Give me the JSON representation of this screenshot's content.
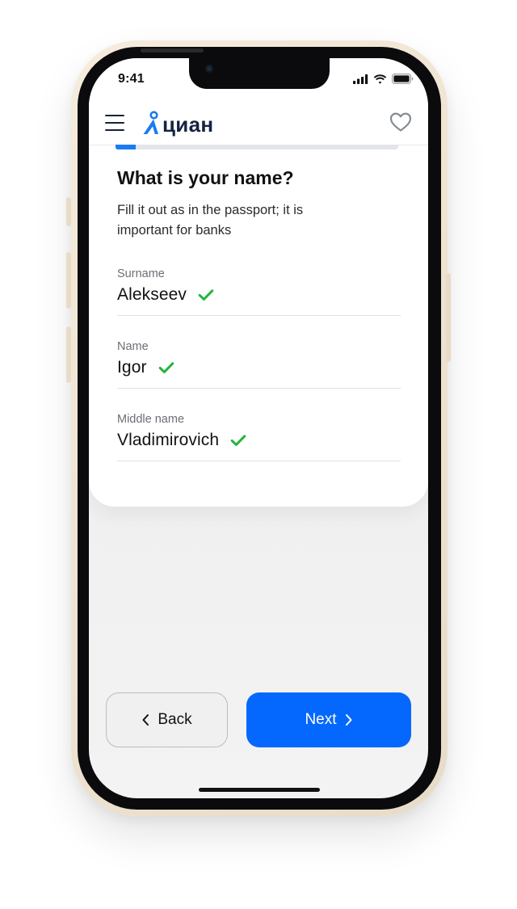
{
  "status_bar": {
    "time": "9:41"
  },
  "header": {
    "logo_text": "циан",
    "menu_icon": "hamburger-menu-icon",
    "favorite_icon": "heart-outline-icon"
  },
  "progress": {
    "fraction": 0.07
  },
  "form": {
    "title": "What is your name?",
    "subtitle": "Fill it out as in the passport; it is important for banks",
    "fields": [
      {
        "label": "Surname",
        "value": "Alekseev",
        "valid": true
      },
      {
        "label": "Name",
        "value": "Igor",
        "valid": true
      },
      {
        "label": "Middle name",
        "value": "Vladimirovich",
        "valid": true
      }
    ]
  },
  "buttons": {
    "back_label": "Back",
    "next_label": "Next"
  },
  "colors": {
    "brand_blue": "#0468FF",
    "progress_blue": "#1A7BF0",
    "check_green": "#22B53C",
    "logo_navy": "#152242"
  }
}
